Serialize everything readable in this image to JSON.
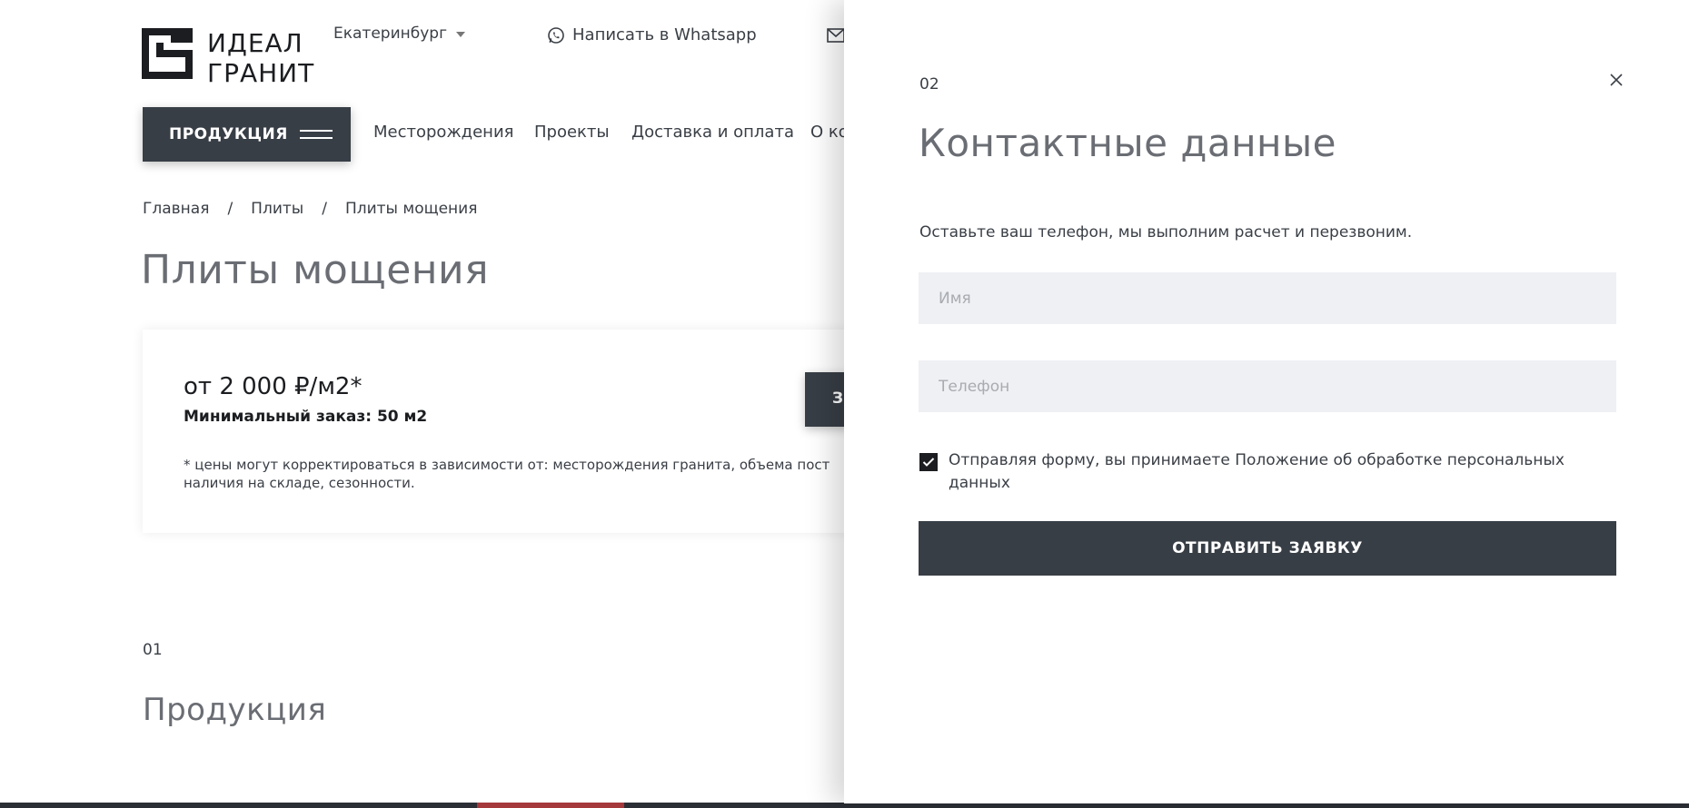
{
  "header": {
    "logo_line1": "ИДЕАЛ",
    "logo_line2": "ГРАНИТ",
    "city": "Екатеринбург",
    "whatsapp_label": "Написать в Whatsapp",
    "products_button": "ПРОДУКЦИЯ"
  },
  "nav": {
    "items": [
      "Месторождения",
      "Проекты",
      "Доставка и оплата",
      "О ко"
    ]
  },
  "breadcrumb": [
    "Главная",
    "Плиты",
    "Плиты мощения"
  ],
  "breadcrumb_sep": "/",
  "page": {
    "title": "Плиты мощения",
    "price": "от 2 000 ₽/м2*",
    "min_order": "Минимальный заказ: 50 м2",
    "note_line1": "* цены могут корректироваться в зависимости от: месторождения гранита, объема пост",
    "note_line2": "наличия на складе, сезонности.",
    "order_button_partial": "З",
    "section_num": "01",
    "section_title": "Продукция"
  },
  "modal": {
    "step": "02",
    "title": "Контактные данные",
    "description": "Оставьте ваш телефон, мы выполним расчет и перезвоним.",
    "name_placeholder": "Имя",
    "phone_placeholder": "Телефон",
    "consent_text": "Отправляя форму, вы принимаете Положение об обработке персональных данных",
    "consent_checked": true,
    "submit_label": "ОТПРАВИТЬ ЗАЯВКУ"
  },
  "colors": {
    "dark_button": "#383e46",
    "input_bg": "#eff0f3",
    "title_gray": "#6a6d73",
    "accent_red": "#a4383b"
  },
  "icons": {
    "logo": "logo-mark-icon",
    "city_caret": "chevron-down-icon",
    "whatsapp": "whatsapp-icon",
    "mail": "mail-icon",
    "menu": "burger-icon",
    "close": "close-icon",
    "check": "check-icon"
  }
}
